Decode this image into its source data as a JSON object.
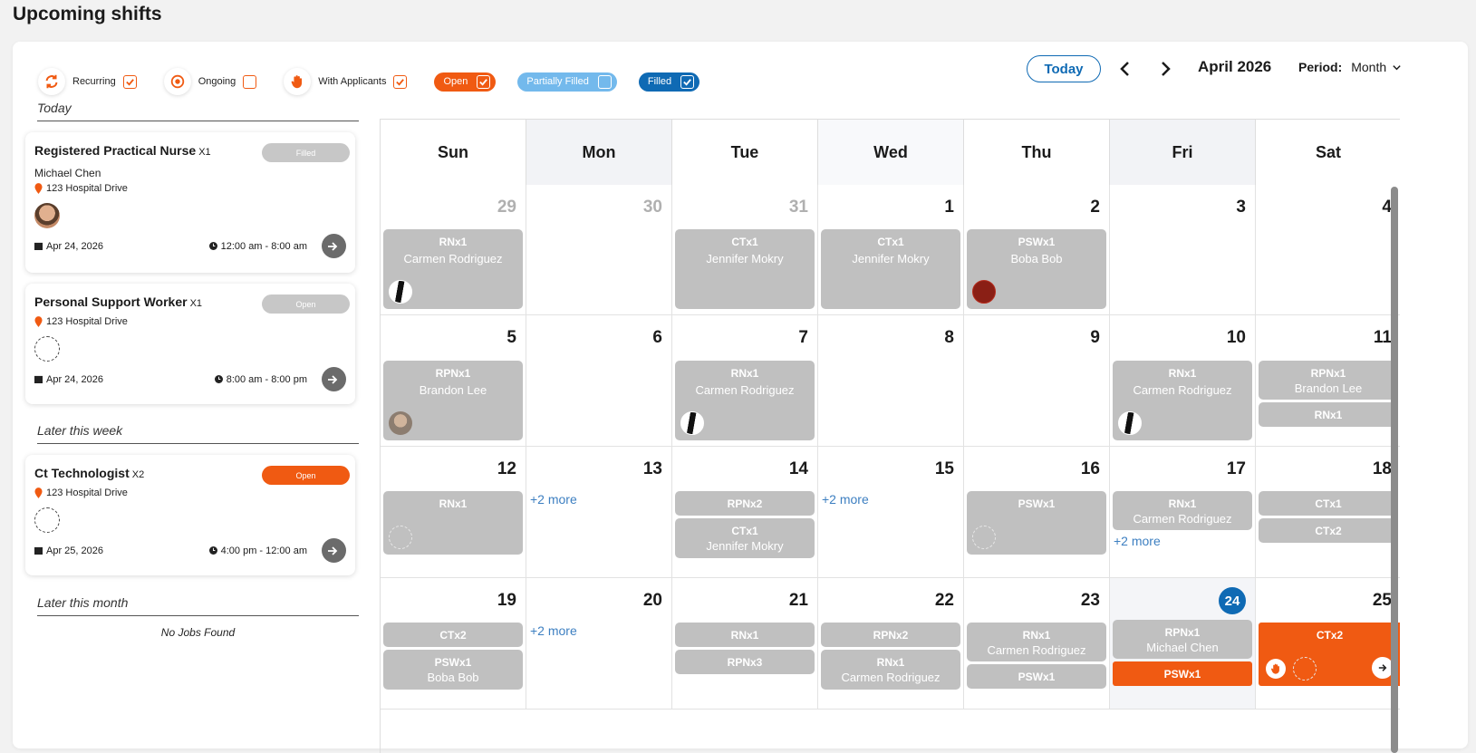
{
  "page_title": "Upcoming shifts",
  "filters": {
    "recurring": {
      "label": "Recurring",
      "checked": true,
      "icon": "recurring-icon"
    },
    "ongoing": {
      "label": "Ongoing",
      "checked": false,
      "icon": "target-icon"
    },
    "with_applicants": {
      "label": "With Applicants",
      "checked": true,
      "icon": "hand-icon"
    },
    "open": {
      "label": "Open",
      "checked": true
    },
    "partially_filled": {
      "label": "Partially Filled",
      "checked": false
    },
    "filled": {
      "label": "Filled",
      "checked": true
    }
  },
  "header": {
    "today_label": "Today",
    "month_label": "April 2026",
    "period_label": "Period:",
    "period_value": "Month"
  },
  "sections": {
    "today": "Today",
    "later_week": "Later this week",
    "later_month": "Later this month",
    "no_jobs": "No Jobs Found"
  },
  "shift_cards": [
    {
      "title": "Registered Practical Nurse",
      "mult": "X1",
      "badge": "Filled",
      "name": "Michael Chen",
      "location": "123 Hospital Drive",
      "date": "Apr 24, 2026",
      "time": "12:00 am - 8:00 am"
    },
    {
      "title": "Personal Support Worker",
      "mult": "X1",
      "badge": "Open",
      "location": "123 Hospital Drive",
      "date": "Apr 24, 2026",
      "time": "8:00 am - 8:00 pm"
    },
    {
      "title": "Ct Technologist",
      "mult": "X2",
      "badge": "Open",
      "location": "123 Hospital Drive",
      "date": "Apr 25, 2026",
      "time": "4:00 pm - 12:00 am"
    }
  ],
  "weekdays": [
    "Sun",
    "Mon",
    "Tue",
    "Wed",
    "Thu",
    "Fri",
    "Sat"
  ],
  "days": [
    "29",
    "30",
    "31",
    "1",
    "2",
    "3",
    "4",
    "5",
    "6",
    "7",
    "8",
    "9",
    "10",
    "11",
    "12",
    "13",
    "14",
    "15",
    "16",
    "17",
    "18",
    "19",
    "20",
    "21",
    "22",
    "23",
    "24",
    "25"
  ],
  "more_label": "+2 more",
  "events": {
    "e0": {
      "role": "RNx1",
      "name": "Carmen Rodriguez"
    },
    "e1": {
      "role": "CTx1",
      "name": "Jennifer Mokry"
    },
    "e2": {
      "role": "CTx1",
      "name": "Jennifer Mokry"
    },
    "e3": {
      "role": "PSWx1",
      "name": "Boba Bob"
    },
    "e4": {
      "role": "RPNx1",
      "name": "Brandon Lee"
    },
    "e5": {
      "role": "RNx1",
      "name": "Carmen Rodriguez"
    },
    "e6": {
      "role": "RNx1",
      "name": "Carmen Rodriguez"
    },
    "e7": {
      "role": "RPNx1",
      "name": "Brandon Lee"
    },
    "e8": {
      "role": "RNx1"
    },
    "e9": {
      "role": "RNx1"
    },
    "e10": {
      "role": "RPNx2"
    },
    "e11": {
      "role": "CTx1",
      "name": "Jennifer Mokry"
    },
    "e12": {
      "role": "PSWx1"
    },
    "e13": {
      "role": "RNx1",
      "name": "Carmen Rodriguez"
    },
    "e14": {
      "role": "CTx1"
    },
    "e15": {
      "role": "CTx2"
    },
    "e16": {
      "role": "CTx2"
    },
    "e17": {
      "role": "PSWx1",
      "name": "Boba Bob"
    },
    "e18": {
      "role": "RNx1"
    },
    "e19": {
      "role": "RPNx3"
    },
    "e20": {
      "role": "RPNx2"
    },
    "e21": {
      "role": "RNx1",
      "name": "Carmen Rodriguez"
    },
    "e22": {
      "role": "RNx1",
      "name": "Carmen Rodriguez"
    },
    "e23": {
      "role": "PSWx1"
    },
    "e24": {
      "role": "RPNx1",
      "name": "Michael Chen"
    },
    "e25": {
      "role": "PSWx1"
    },
    "e26": {
      "role": "CTx2"
    }
  },
  "colors": {
    "accent_orange": "#f05a12",
    "accent_blue": "#0f6ab4",
    "event_grey": "#c0c0c0"
  }
}
